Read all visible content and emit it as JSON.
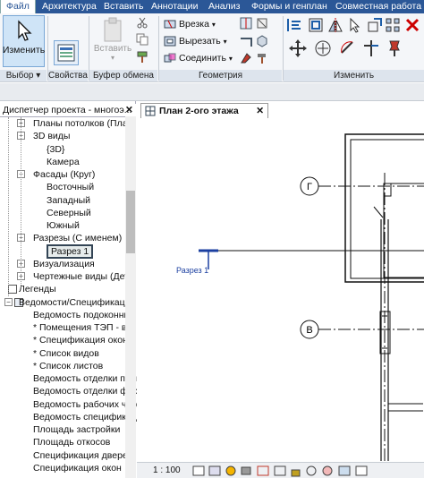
{
  "menubar": {
    "tabs": [
      "Файл",
      "Архитектура",
      "Вставить",
      "Аннотации",
      "Анализ",
      "Формы и генплан",
      "Совместная работа"
    ]
  },
  "ribbon": {
    "modify_button": "Изменить",
    "insert_button": "Вставить",
    "panels": {
      "select": "Выбор",
      "properties": "Свойства",
      "clipboard": "Буфер обмена",
      "geometry": "Геометрия",
      "modify": "Изменить"
    },
    "geometry_items": {
      "cut": "Врезка",
      "cutout": "Вырезать",
      "join": "Соединить"
    }
  },
  "project_browser": {
    "title": "Диспетчер проекта - многоэ...",
    "items": [
      {
        "label": "Планы потолков (План",
        "level": 2,
        "expander": "+"
      },
      {
        "label": "3D виды",
        "level": 2,
        "expander": "-"
      },
      {
        "label": "{3D}",
        "level": 3
      },
      {
        "label": "Камера",
        "level": 3
      },
      {
        "label": "Фасады (Круг)",
        "level": 2,
        "expander": "-"
      },
      {
        "label": "Восточный",
        "level": 3
      },
      {
        "label": "Западный",
        "level": 3
      },
      {
        "label": "Северный",
        "level": 3
      },
      {
        "label": "Южный",
        "level": 3
      },
      {
        "label": "Разрезы (С именем)",
        "level": 2,
        "expander": "-"
      },
      {
        "label": "Разрез 1",
        "level": 3,
        "selected": true
      },
      {
        "label": "Визуализация",
        "level": 2,
        "expander": "+"
      },
      {
        "label": "Чертежные виды (Дета",
        "level": 2,
        "expander": "+"
      },
      {
        "label": "Легенды",
        "level": 1
      },
      {
        "label": "Ведомости/Спецификаци",
        "level": 1,
        "expander": "-"
      },
      {
        "label": "Ведомость подоконни",
        "level": 2
      },
      {
        "label": "* Помещения ТЭП - все",
        "level": 2
      },
      {
        "label": "* Спецификация окон д",
        "level": 2
      },
      {
        "label": "* Список видов",
        "level": 2
      },
      {
        "label": "* Список листов",
        "level": 2
      },
      {
        "label": "Ведомость отделки пом",
        "level": 2
      },
      {
        "label": "Ведомость отделки фас",
        "level": 2
      },
      {
        "label": "Ведомость рабочих чер",
        "level": 2
      },
      {
        "label": "Ведомость спецификац",
        "level": 2
      },
      {
        "label": "Площадь застройки",
        "level": 2
      },
      {
        "label": "Площадь откосов",
        "level": 2
      },
      {
        "label": "Спецификация дверей",
        "level": 2
      },
      {
        "label": "Спецификация окон",
        "level": 2
      }
    ]
  },
  "view": {
    "tab_title": "План 2-ого этажа",
    "grid_labels": [
      "Г",
      "В"
    ],
    "section_label": "Разрез 1",
    "scale": "1 : 100"
  },
  "colors": {
    "menubar": "#2b5797",
    "section_blue": "#1b3fa0"
  }
}
